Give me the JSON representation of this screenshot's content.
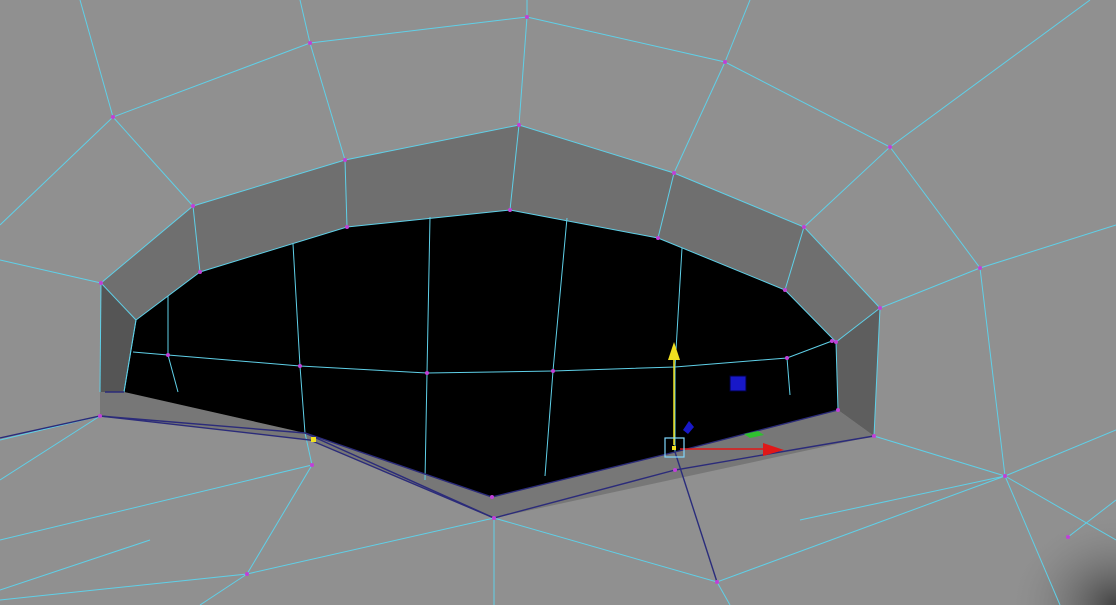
{
  "viewport": {
    "description_icon": "3d-modeling-viewport",
    "colors": {
      "background": "#8d8d8d",
      "mesh_face": "#909090",
      "rim_face": "#6e6e6e",
      "rim_face_dark": "#5a5a5a",
      "hole": "#000000",
      "wire": "#5fd0e8",
      "wire_selected": "#2b2b7a",
      "vertex": "#c040d8",
      "vertex_selected": "#f0e020",
      "gizmo_y": "#f0e020",
      "gizmo_x": "#e01818",
      "gizmo_z": "#1818c8",
      "gizmo_plane": "#30c030",
      "gizmo_center": "#7fd8ff"
    }
  },
  "gizmo": {
    "icon_names": [
      "move-y-arrow-icon",
      "move-x-arrow-icon",
      "move-z-handle-icon",
      "xy-plane-handle-icon",
      "move-center-handle-icon"
    ]
  }
}
